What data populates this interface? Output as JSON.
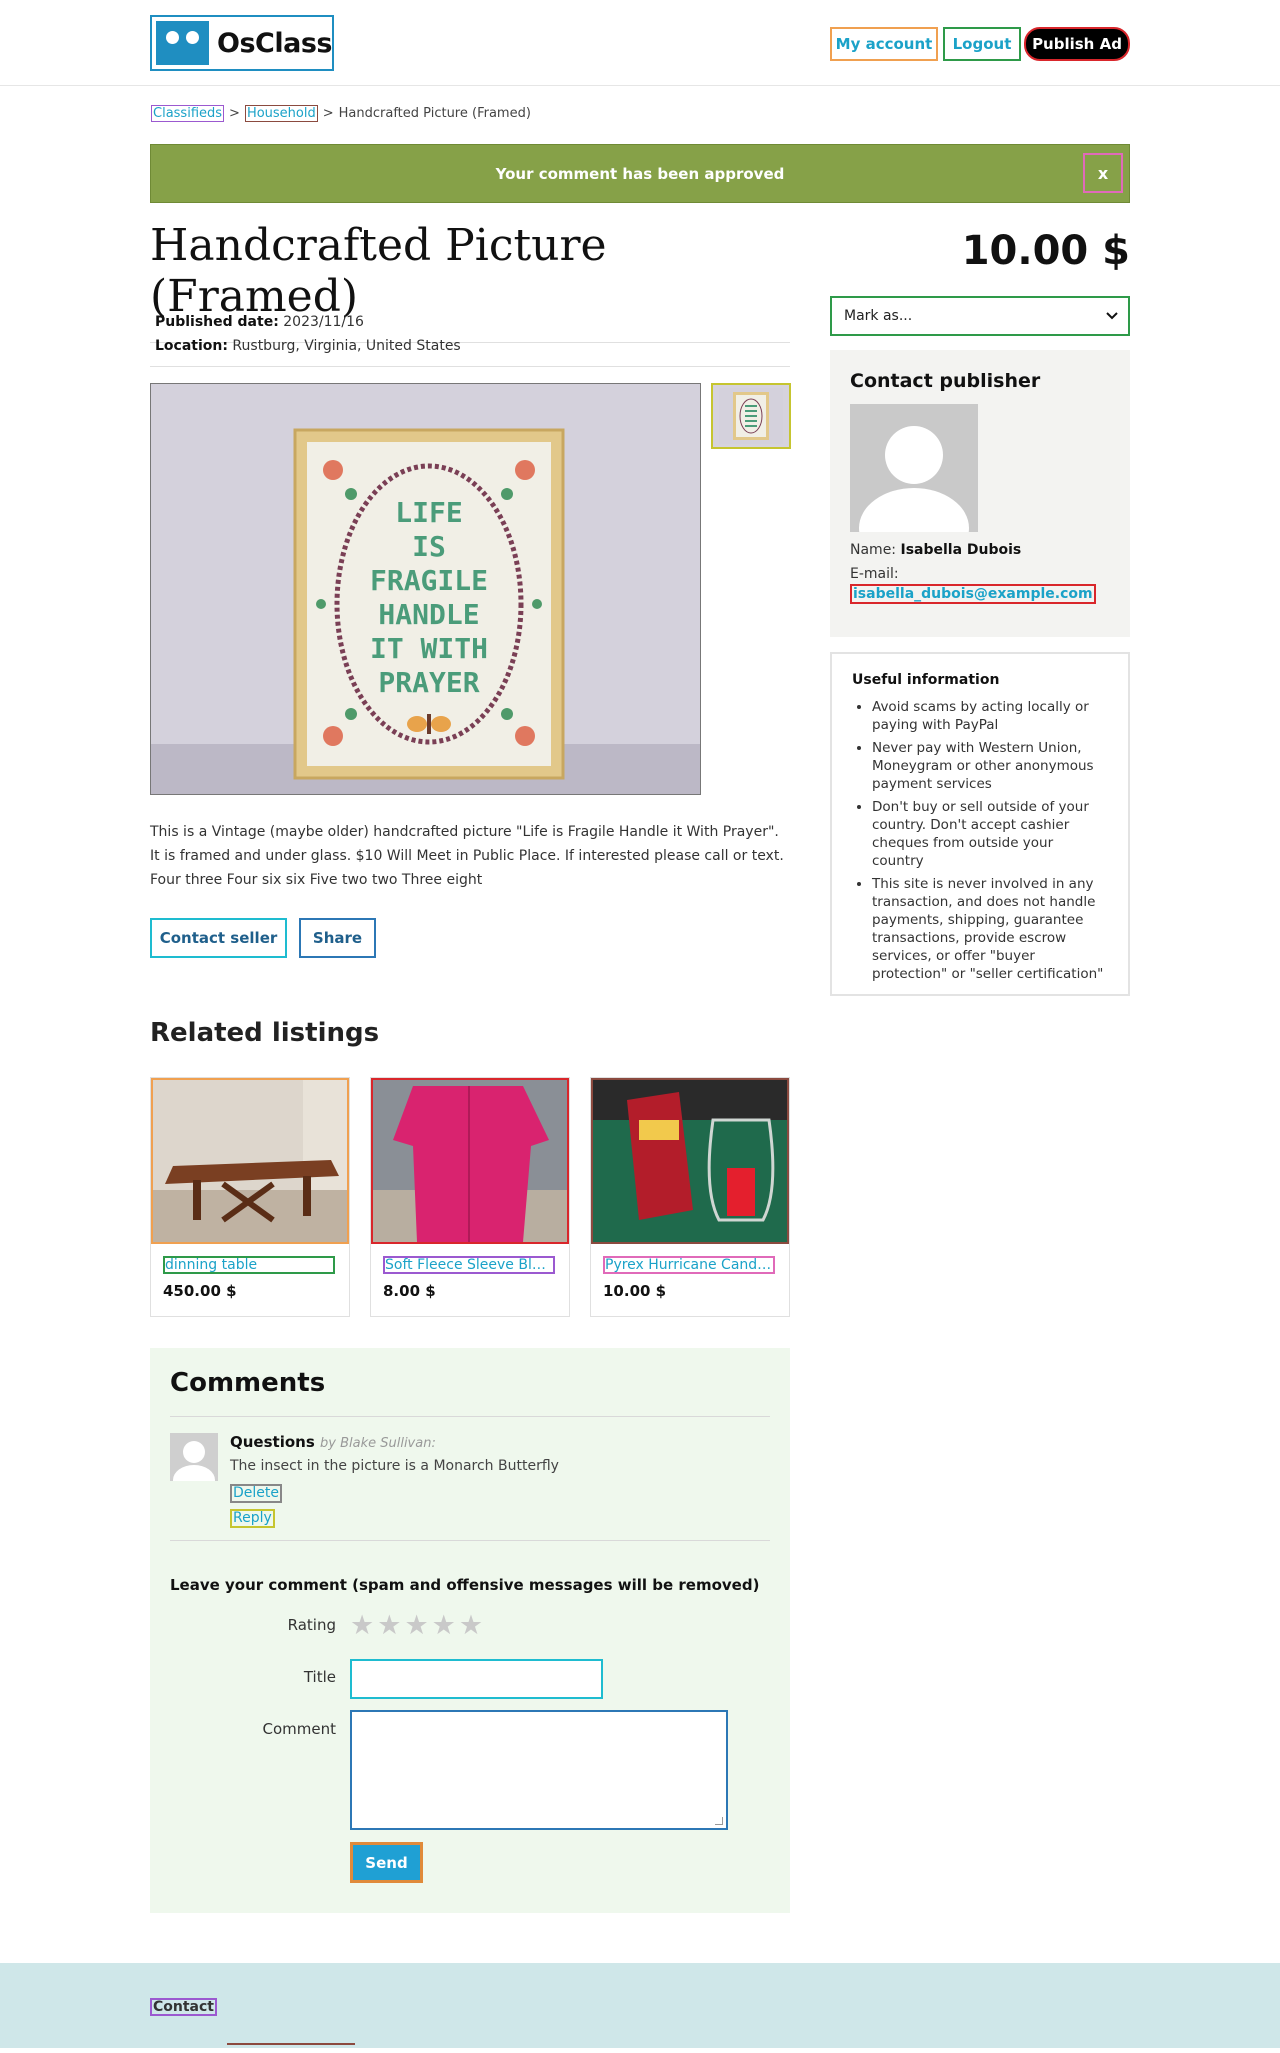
{
  "header": {
    "logo_text": "OsClass",
    "my_account": "My account",
    "logout": "Logout",
    "publish_ad": "Publish Ad"
  },
  "breadcrumb": {
    "items": [
      "Classifieds",
      "Household"
    ],
    "separator": ">",
    "current": "Handcrafted Picture (Framed)"
  },
  "flash": {
    "message": "Your comment has been approved",
    "close": "x",
    "color": "#86a148"
  },
  "item": {
    "title": "Handcrafted Picture (Framed)",
    "price": "10.00 $",
    "published_label": "Published date:",
    "published_value": "2023/11/16",
    "location_label": "Location:",
    "location_value": "Rustburg, Virginia, United States",
    "photo_text": "LIFE IS FRAGILE HANDLE IT WITH PRAYER",
    "description": "This is a Vintage (maybe older) handcrafted picture \"Life is Fragile Handle it With Prayer\". It is framed and under glass. $10 Will Meet in Public Place. If interested please call or text. Four three Four six six Five two two Three eight",
    "contact_seller": "Contact seller",
    "share": "Share"
  },
  "sidebar": {
    "mark_as": "Mark as...",
    "contact_title": "Contact publisher",
    "name_label": "Name:",
    "name_value": "Isabella Dubois",
    "email_label": "E-mail:",
    "email_value": "isabella_dubois@example.com",
    "useful_title": "Useful information",
    "useful_items": [
      "Avoid scams by acting locally or paying with PayPal",
      "Never pay with Western Union, Moneygram or other anonymous payment services",
      "Don't buy or sell outside of your country. Don't accept cashier cheques from outside your country",
      "This site is never involved in any transaction, and does not handle payments, shipping, guarantee transactions, provide escrow services, or offer \"buyer protection\" or \"seller certification\""
    ]
  },
  "related": {
    "title": "Related listings",
    "items": [
      {
        "title": "dinning table",
        "price": "450.00 $"
      },
      {
        "title": "Soft Fleece Sleeve Blanket",
        "price": "8.00 $"
      },
      {
        "title": "Pyrex Hurricane Candle Centerpiece",
        "price": "10.00 $"
      }
    ]
  },
  "comments": {
    "title": "Comments",
    "list": [
      {
        "title": "Questions",
        "by": "by Blake Sullivan:",
        "body": "The insect in the picture is a Monarch Butterfly",
        "delete": "Delete",
        "reply": "Reply"
      }
    ],
    "leave_title": "Leave your comment (spam and offensive messages will be removed)",
    "rating_label": "Rating",
    "rating_value": 0,
    "title_label": "Title",
    "comment_label": "Comment",
    "send": "Send"
  },
  "footer": {
    "contact": "Contact"
  }
}
